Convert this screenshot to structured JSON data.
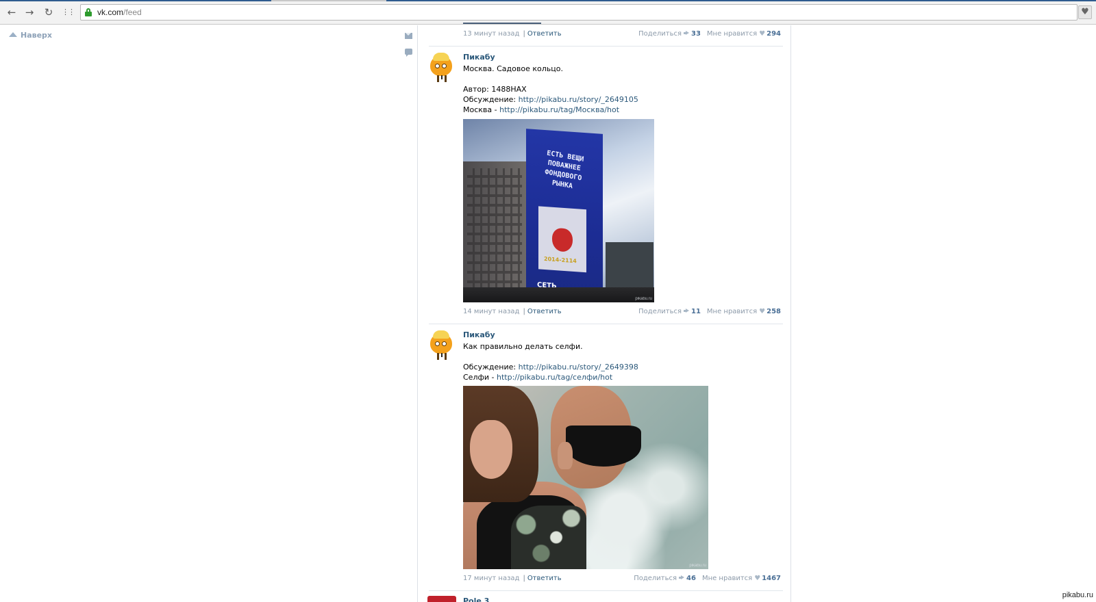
{
  "browser": {
    "url_host": "vk.com",
    "url_path": "/feed",
    "back_icon": "←",
    "forward_icon": "→",
    "reload_icon": "↻",
    "apps_icon": "⋮⋮",
    "bookmark_icon": "♥"
  },
  "left_nav": {
    "to_top_label": "Наверх"
  },
  "posts": [
    {
      "time": "13 минут назад",
      "reply_label": "Ответить",
      "share_label": "Поделиться",
      "share_count": "33",
      "like_label": "Мне нравится",
      "like_count": "294"
    },
    {
      "author": "Пикабу",
      "lines": [
        "Москва. Садовое кольцо.",
        "",
        "Автор: 1488HAX"
      ],
      "discussion_label": "Обсуждение: ",
      "discussion_link": "http://pikabu.ru/story/_2649105",
      "tag_label": "Москва - ",
      "tag_link": "http://pikabu.ru/tag/Москва/hot",
      "photo": {
        "wall_text": "ЕСТЬ ВЕЩИ ПОВАЖНЕЕ ФОНДОВОГО РЫНКА",
        "panel_years": "2014-2114",
        "logo": "СЕТЬ",
        "watermark": "pikabu.ru"
      },
      "time": "14 минут назад",
      "reply_label": "Ответить",
      "share_label": "Поделиться",
      "share_count": "11",
      "like_label": "Мне нравится",
      "like_count": "258"
    },
    {
      "author": "Пикабу",
      "lines": [
        "Как правильно делать селфи.",
        ""
      ],
      "discussion_label": "Обсуждение: ",
      "discussion_link": "http://pikabu.ru/story/_2649398",
      "tag_label": "Селфи - ",
      "tag_link": "http://pikabu.ru/tag/селфи/hot",
      "photo": {
        "watermark": "pikabu.ru"
      },
      "time": "17 минут назад",
      "reply_label": "Ответить",
      "share_label": "Поделиться",
      "share_count": "46",
      "like_label": "Мне нравится",
      "like_count": "1467"
    },
    {
      "author": "Pole 3"
    }
  ],
  "site_watermark": "pikabu.ru"
}
